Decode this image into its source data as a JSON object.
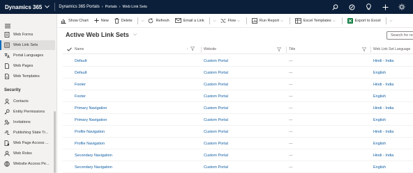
{
  "topbar": {
    "app_name": "Dynamics 365",
    "breadcrumb": [
      "Dynamics 365 Portals",
      "Portals",
      "Web Link Sets"
    ]
  },
  "sidebar": {
    "items_top": [
      {
        "label": "Web Forms",
        "icon": "form-icon"
      },
      {
        "label": "Web Link Sets",
        "icon": "link-set-icon",
        "selected": true
      },
      {
        "label": "Portal Languages",
        "icon": "language-icon"
      },
      {
        "label": "Web Pages",
        "icon": "page-icon"
      },
      {
        "label": "Web Templates",
        "icon": "template-icon"
      }
    ],
    "security_label": "Security",
    "items_security": [
      {
        "label": "Contacts",
        "icon": "person-icon"
      },
      {
        "label": "Entity Permissions",
        "icon": "key-icon"
      },
      {
        "label": "Invitations",
        "icon": "invitation-icon"
      },
      {
        "label": "Publishing State Tr...",
        "icon": "publishing-icon"
      },
      {
        "label": "Web Page Access ...",
        "icon": "page-access-icon"
      },
      {
        "label": "Web Roles",
        "icon": "role-icon"
      },
      {
        "label": "Website Access Pe...",
        "icon": "website-access-icon"
      }
    ]
  },
  "commandbar": {
    "show_chart": "Show Chart",
    "new": "New",
    "delete": "Delete",
    "refresh": "Refresh",
    "email_link": "Email a Link",
    "flow": "Flow",
    "run_report": "Run Report",
    "excel_templates": "Excel Templates",
    "export_excel": "Export to Excel"
  },
  "view": {
    "title": "Active Web Link Sets",
    "search_placeholder": "Search for records"
  },
  "grid": {
    "columns": [
      "Name",
      "Website",
      "Title",
      "Web Link Set Language"
    ],
    "rows": [
      {
        "name": "Default",
        "website": "Custom Portal",
        "title": "---",
        "language": "Hindi - India"
      },
      {
        "name": "Default",
        "website": "Custom Portal",
        "title": "---",
        "language": "English"
      },
      {
        "name": "Footer",
        "website": "Custom Portal",
        "title": "---",
        "language": "Hindi - India"
      },
      {
        "name": "Footer",
        "website": "Custom Portal",
        "title": "---",
        "language": "English"
      },
      {
        "name": "Primary Navigation",
        "website": "Custom Portal",
        "title": "---",
        "language": "Hindi - India"
      },
      {
        "name": "Primary Navigation",
        "website": "Custom Portal",
        "title": "---",
        "language": "English"
      },
      {
        "name": "Profile Navigation",
        "website": "Custom Portal",
        "title": "---",
        "language": "Hindi - India"
      },
      {
        "name": "Profile Navigation",
        "website": "Custom Portal",
        "title": "---",
        "language": "English"
      },
      {
        "name": "Secondary Navigation",
        "website": "Custom Portal",
        "title": "---",
        "language": "Hindi - India"
      },
      {
        "name": "Secondary Navigation",
        "website": "Custom Portal",
        "title": "---",
        "language": "English"
      }
    ]
  },
  "colors": {
    "topbar": "#0b1f3a",
    "link": "#115ea3",
    "accent": "#0f6cbd"
  }
}
